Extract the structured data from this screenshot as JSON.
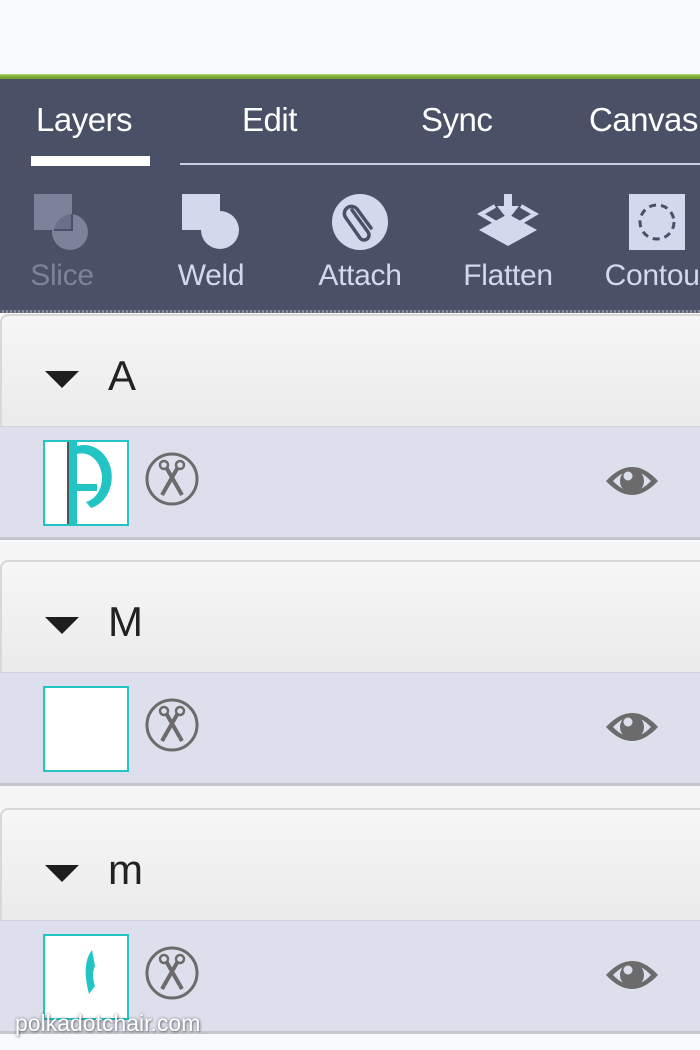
{
  "colors": {
    "accent_green": "#8ab93b",
    "panel_bg": "#4a5066",
    "tool_icon": "#d3d9ec",
    "tool_disabled": "#7c8299",
    "layer_row_bg": "#dde0ec",
    "thumb_border": "#22c4c4",
    "shape_fill": "#22c4c4",
    "icon_gray": "#6b6b6b"
  },
  "tabs": [
    {
      "label": "Layers",
      "active": true
    },
    {
      "label": "Edit",
      "active": false
    },
    {
      "label": "Sync",
      "active": false
    },
    {
      "label": "Canvas",
      "active": false
    }
  ],
  "tools": [
    {
      "label": "Slice",
      "icon": "slice-icon",
      "enabled": false
    },
    {
      "label": "Weld",
      "icon": "weld-icon",
      "enabled": true
    },
    {
      "label": "Attach",
      "icon": "attach-paperclip-icon",
      "enabled": true
    },
    {
      "label": "Flatten",
      "icon": "flatten-icon",
      "enabled": true
    },
    {
      "label": "Contour",
      "icon": "contour-icon",
      "enabled": true
    }
  ],
  "groups": [
    {
      "name": "A",
      "expanded": true,
      "layers": [
        {
          "thumbnail": "letter-A-shape",
          "operation": "cut",
          "visible": true
        }
      ]
    },
    {
      "name": "M",
      "expanded": true,
      "layers": [
        {
          "thumbnail": "blank",
          "operation": "cut",
          "visible": true
        }
      ]
    },
    {
      "name": "m",
      "expanded": true,
      "layers": [
        {
          "thumbnail": "letter-m-fragment",
          "operation": "cut",
          "visible": true
        }
      ]
    }
  ],
  "watermark": "polkadotchair.com"
}
